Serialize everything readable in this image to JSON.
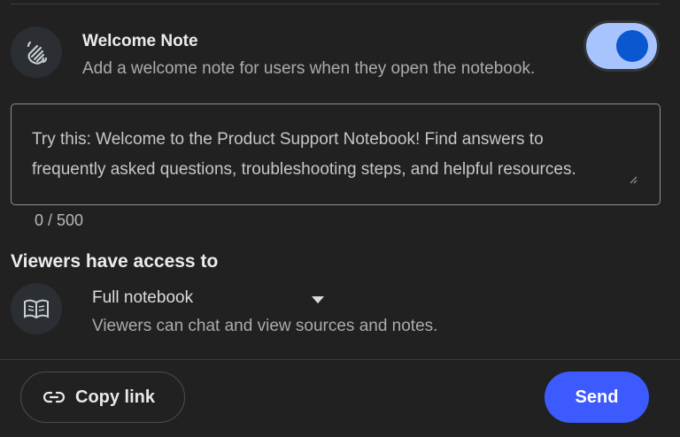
{
  "welcome": {
    "icon": "waving-hand-icon",
    "title": "Welcome Note",
    "description": "Add a welcome note for users when they open the notebook.",
    "enabled": true
  },
  "note_input": {
    "placeholder_line_1": "Try this: Welcome to the Product Support Notebook! Find answers to",
    "placeholder_line_2": "frequently asked questions, troubleshooting steps, and helpful resources.",
    "char_count": "0 / 500"
  },
  "access": {
    "heading": "Viewers have access to",
    "icon": "book-open-icon",
    "selected": "Full notebook",
    "description": "Viewers can chat and view sources and notes."
  },
  "footer": {
    "copy_link_icon": "link-icon",
    "copy_link_label": "Copy link",
    "send_label": "Send"
  },
  "colors": {
    "background": "#212121",
    "toggle_track": "#a7c4ff",
    "toggle_knob": "#0b57d0",
    "send_button": "#3d5afe"
  }
}
